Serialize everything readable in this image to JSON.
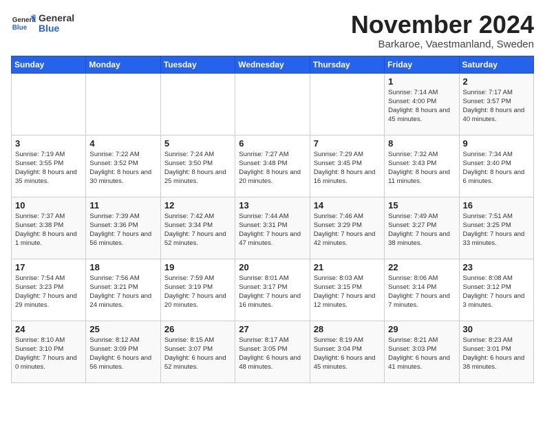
{
  "logo": {
    "general": "General",
    "blue": "Blue"
  },
  "title": "November 2024",
  "location": "Barkaroe, Vaestmanland, Sweden",
  "days_of_week": [
    "Sunday",
    "Monday",
    "Tuesday",
    "Wednesday",
    "Thursday",
    "Friday",
    "Saturday"
  ],
  "weeks": [
    [
      {
        "day": "",
        "info": ""
      },
      {
        "day": "",
        "info": ""
      },
      {
        "day": "",
        "info": ""
      },
      {
        "day": "",
        "info": ""
      },
      {
        "day": "",
        "info": ""
      },
      {
        "day": "1",
        "info": "Sunrise: 7:14 AM\nSunset: 4:00 PM\nDaylight: 8 hours and 45 minutes."
      },
      {
        "day": "2",
        "info": "Sunrise: 7:17 AM\nSunset: 3:57 PM\nDaylight: 8 hours and 40 minutes."
      }
    ],
    [
      {
        "day": "3",
        "info": "Sunrise: 7:19 AM\nSunset: 3:55 PM\nDaylight: 8 hours and 35 minutes."
      },
      {
        "day": "4",
        "info": "Sunrise: 7:22 AM\nSunset: 3:52 PM\nDaylight: 8 hours and 30 minutes."
      },
      {
        "day": "5",
        "info": "Sunrise: 7:24 AM\nSunset: 3:50 PM\nDaylight: 8 hours and 25 minutes."
      },
      {
        "day": "6",
        "info": "Sunrise: 7:27 AM\nSunset: 3:48 PM\nDaylight: 8 hours and 20 minutes."
      },
      {
        "day": "7",
        "info": "Sunrise: 7:29 AM\nSunset: 3:45 PM\nDaylight: 8 hours and 16 minutes."
      },
      {
        "day": "8",
        "info": "Sunrise: 7:32 AM\nSunset: 3:43 PM\nDaylight: 8 hours and 11 minutes."
      },
      {
        "day": "9",
        "info": "Sunrise: 7:34 AM\nSunset: 3:40 PM\nDaylight: 8 hours and 6 minutes."
      }
    ],
    [
      {
        "day": "10",
        "info": "Sunrise: 7:37 AM\nSunset: 3:38 PM\nDaylight: 8 hours and 1 minute."
      },
      {
        "day": "11",
        "info": "Sunrise: 7:39 AM\nSunset: 3:36 PM\nDaylight: 7 hours and 56 minutes."
      },
      {
        "day": "12",
        "info": "Sunrise: 7:42 AM\nSunset: 3:34 PM\nDaylight: 7 hours and 52 minutes."
      },
      {
        "day": "13",
        "info": "Sunrise: 7:44 AM\nSunset: 3:31 PM\nDaylight: 7 hours and 47 minutes."
      },
      {
        "day": "14",
        "info": "Sunrise: 7:46 AM\nSunset: 3:29 PM\nDaylight: 7 hours and 42 minutes."
      },
      {
        "day": "15",
        "info": "Sunrise: 7:49 AM\nSunset: 3:27 PM\nDaylight: 7 hours and 38 minutes."
      },
      {
        "day": "16",
        "info": "Sunrise: 7:51 AM\nSunset: 3:25 PM\nDaylight: 7 hours and 33 minutes."
      }
    ],
    [
      {
        "day": "17",
        "info": "Sunrise: 7:54 AM\nSunset: 3:23 PM\nDaylight: 7 hours and 29 minutes."
      },
      {
        "day": "18",
        "info": "Sunrise: 7:56 AM\nSunset: 3:21 PM\nDaylight: 7 hours and 24 minutes."
      },
      {
        "day": "19",
        "info": "Sunrise: 7:59 AM\nSunset: 3:19 PM\nDaylight: 7 hours and 20 minutes."
      },
      {
        "day": "20",
        "info": "Sunrise: 8:01 AM\nSunset: 3:17 PM\nDaylight: 7 hours and 16 minutes."
      },
      {
        "day": "21",
        "info": "Sunrise: 8:03 AM\nSunset: 3:15 PM\nDaylight: 7 hours and 12 minutes."
      },
      {
        "day": "22",
        "info": "Sunrise: 8:06 AM\nSunset: 3:14 PM\nDaylight: 7 hours and 7 minutes."
      },
      {
        "day": "23",
        "info": "Sunrise: 8:08 AM\nSunset: 3:12 PM\nDaylight: 7 hours and 3 minutes."
      }
    ],
    [
      {
        "day": "24",
        "info": "Sunrise: 8:10 AM\nSunset: 3:10 PM\nDaylight: 7 hours and 0 minutes."
      },
      {
        "day": "25",
        "info": "Sunrise: 8:12 AM\nSunset: 3:09 PM\nDaylight: 6 hours and 56 minutes."
      },
      {
        "day": "26",
        "info": "Sunrise: 8:15 AM\nSunset: 3:07 PM\nDaylight: 6 hours and 52 minutes."
      },
      {
        "day": "27",
        "info": "Sunrise: 8:17 AM\nSunset: 3:05 PM\nDaylight: 6 hours and 48 minutes."
      },
      {
        "day": "28",
        "info": "Sunrise: 8:19 AM\nSunset: 3:04 PM\nDaylight: 6 hours and 45 minutes."
      },
      {
        "day": "29",
        "info": "Sunrise: 8:21 AM\nSunset: 3:03 PM\nDaylight: 6 hours and 41 minutes."
      },
      {
        "day": "30",
        "info": "Sunrise: 8:23 AM\nSunset: 3:01 PM\nDaylight: 6 hours and 38 minutes."
      }
    ]
  ],
  "colors": {
    "header_bg": "#2563eb",
    "header_text": "#ffffff"
  }
}
